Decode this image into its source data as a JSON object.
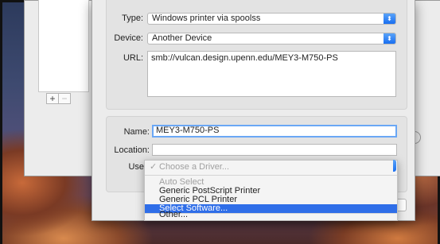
{
  "list_buttons": {
    "add": "+",
    "remove": "−"
  },
  "connection": {
    "type_label": "Type:",
    "type_value": "Windows printer via spoolss",
    "device_label": "Device:",
    "device_value": "Another Device",
    "url_label": "URL:",
    "url_value": "smb://vulcan.design.upenn.edu/MEY3-M750-PS"
  },
  "details": {
    "name_label": "Name:",
    "name_value": "MEY3-M750-PS",
    "location_label": "Location:",
    "location_value": "",
    "use_label": "Use"
  },
  "driver_menu": {
    "checkmark": "✓",
    "current": "Choose a Driver...",
    "items": [
      "Auto Select",
      "Generic PostScript Printer",
      "Generic PCL Printer",
      "Select Software...",
      "Other..."
    ],
    "selected_index": 3
  },
  "icons": {
    "popup_arrows": "chevron-updown-icon",
    "checkmark": "checkmark-icon"
  },
  "colors": {
    "accent": "#2f6ee8",
    "focus_ring": "#6aa7f5"
  }
}
